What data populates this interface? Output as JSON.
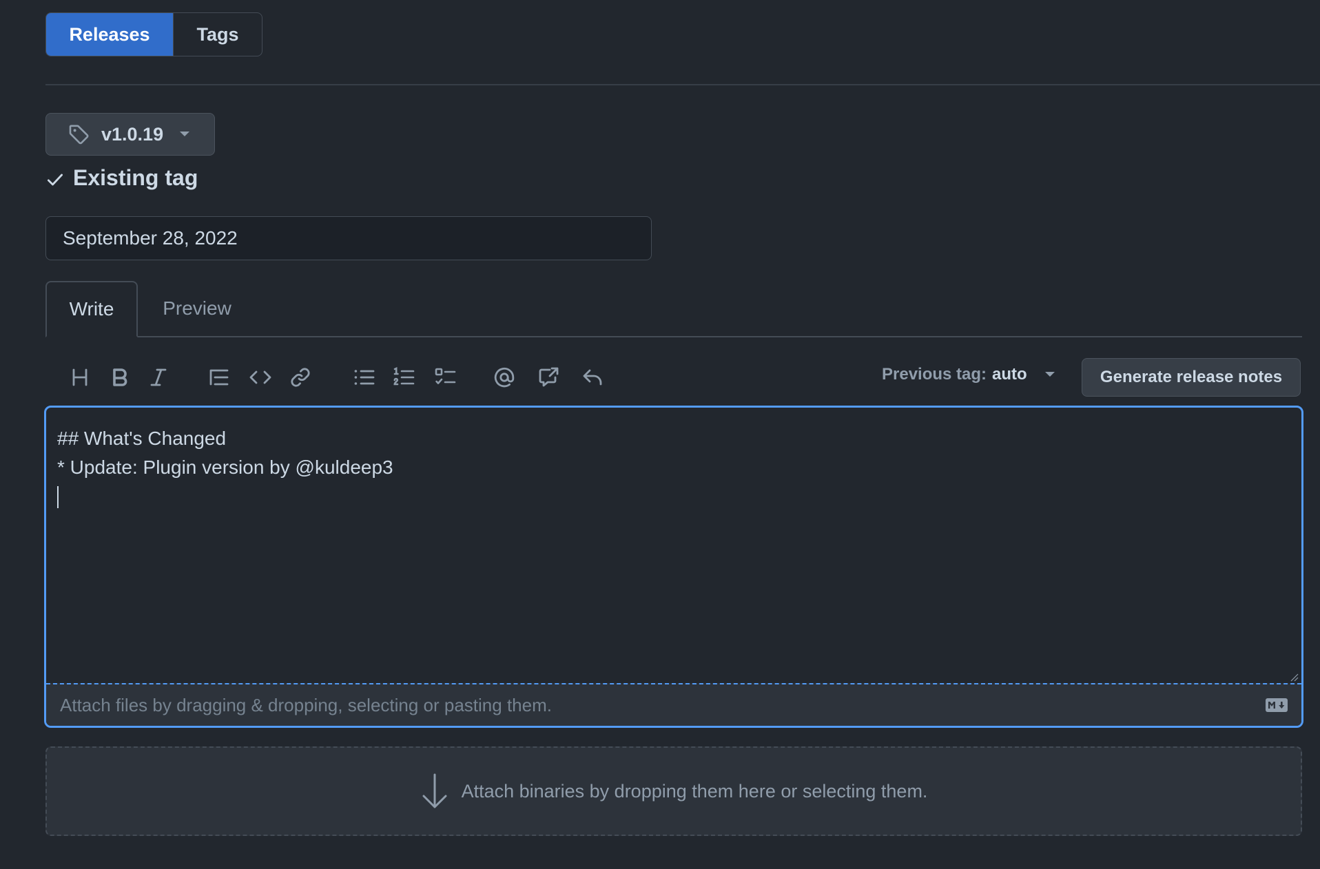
{
  "subnav": {
    "items": [
      {
        "label": "Releases",
        "selected": true
      },
      {
        "label": "Tags",
        "selected": false
      }
    ]
  },
  "tag_selector": {
    "label": "v1.0.19",
    "icon": "tag-icon"
  },
  "tag_status": {
    "label": "Existing tag",
    "icon": "check-icon"
  },
  "release_title": {
    "value": "September 28, 2022"
  },
  "editor_tabs": {
    "write": "Write",
    "preview": "Preview",
    "active": "Write"
  },
  "toolbar": {
    "icons": [
      "heading-icon",
      "bold-icon",
      "italic-icon",
      "quote-icon",
      "code-icon",
      "link-icon",
      "unordered-list-icon",
      "ordered-list-icon",
      "task-list-icon",
      "mention-icon",
      "cross-reference-icon",
      "reply-icon"
    ],
    "previous_tag_label": "Previous tag:",
    "previous_tag_value": "auto",
    "generate_label": "Generate release notes"
  },
  "editor": {
    "lines": [
      "## What's Changed",
      "* Update: Plugin version by @kuldeep3"
    ],
    "attach_hint": "Attach files by dragging & dropping, selecting or pasting them.",
    "markdown_icon": "markdown-icon"
  },
  "dropzone": {
    "label": "Attach binaries by dropping them here or selecting them.",
    "icon": "arrow-down-icon"
  },
  "colors": {
    "background": "#22272e",
    "accent": "#539bf5",
    "selected_tab": "#316dca"
  }
}
